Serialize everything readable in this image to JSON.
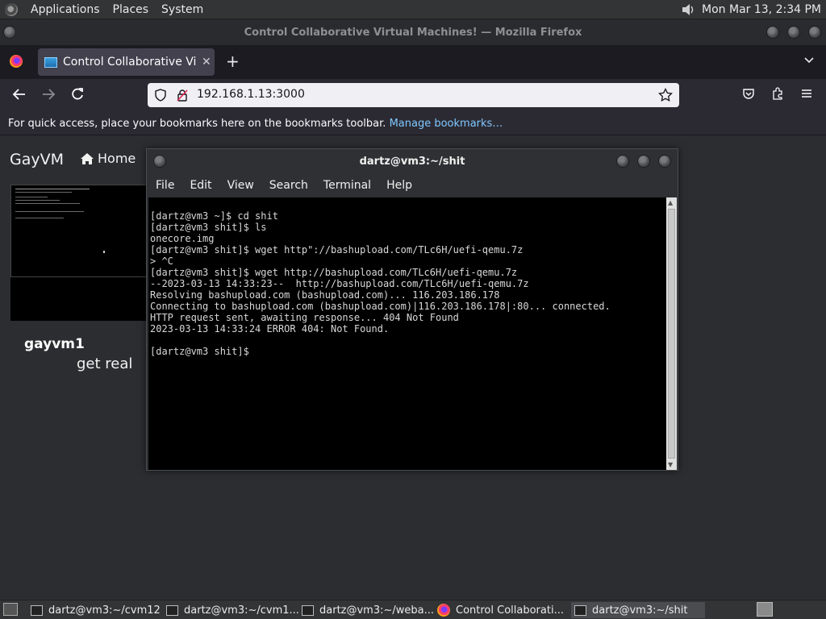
{
  "top_panel": {
    "menus": [
      "Applications",
      "Places",
      "System"
    ],
    "clock": "Mon Mar 13,  2:34 PM"
  },
  "firefox": {
    "window_title": "Control Collaborative Virtual Machines! — Mozilla Firefox",
    "tab_title": "Control Collaborative Virtual Machines!",
    "tab_close": "✕",
    "new_tab": "+",
    "url": "192.168.1.13:3000",
    "bookmarks_text": "For quick access, place your bookmarks here on the bookmarks toolbar.",
    "bookmarks_link": "Manage bookmarks…"
  },
  "page": {
    "brand": "GayVM",
    "nav_home": "Home",
    "vm_name": "gayvm1",
    "vm_description": "get real"
  },
  "terminal": {
    "title": "dartz@vm3:~/shit",
    "menu": [
      "File",
      "Edit",
      "View",
      "Search",
      "Terminal",
      "Help"
    ],
    "lines": [
      "[dartz@vm3 ~]$ cd shit",
      "[dartz@vm3 shit]$ ls",
      "onecore.img",
      "[dartz@vm3 shit]$ wget http\"://bashupload.com/TLc6H/uefi-qemu.7z",
      "> ^C",
      "[dartz@vm3 shit]$ wget http://bashupload.com/TLc6H/uefi-qemu.7z",
      "--2023-03-13 14:33:23--  http://bashupload.com/TLc6H/uefi-qemu.7z",
      "Resolving bashupload.com (bashupload.com)... 116.203.186.178",
      "Connecting to bashupload.com (bashupload.com)|116.203.186.178|:80... connected.",
      "HTTP request sent, awaiting response... 404 Not Found",
      "2023-03-13 14:33:24 ERROR 404: Not Found.",
      "",
      "[dartz@vm3 shit]$ "
    ]
  },
  "taskbar": {
    "items": [
      {
        "label": "dartz@vm3:~/cvm12",
        "icon": "terminal-icon",
        "active": false
      },
      {
        "label": "dartz@vm3:~/cvm1...",
        "icon": "terminal-icon",
        "active": false
      },
      {
        "label": "dartz@vm3:~/weba...",
        "icon": "terminal-icon",
        "active": false
      },
      {
        "label": "Control Collaborati...",
        "icon": "firefox-icon",
        "active": false
      },
      {
        "label": "dartz@vm3:~/shit",
        "icon": "terminal-icon",
        "active": true
      }
    ]
  },
  "colors": {
    "link": "#80c8ff",
    "terminal_bg": "#000000",
    "page_bg": "#2b2d30"
  }
}
